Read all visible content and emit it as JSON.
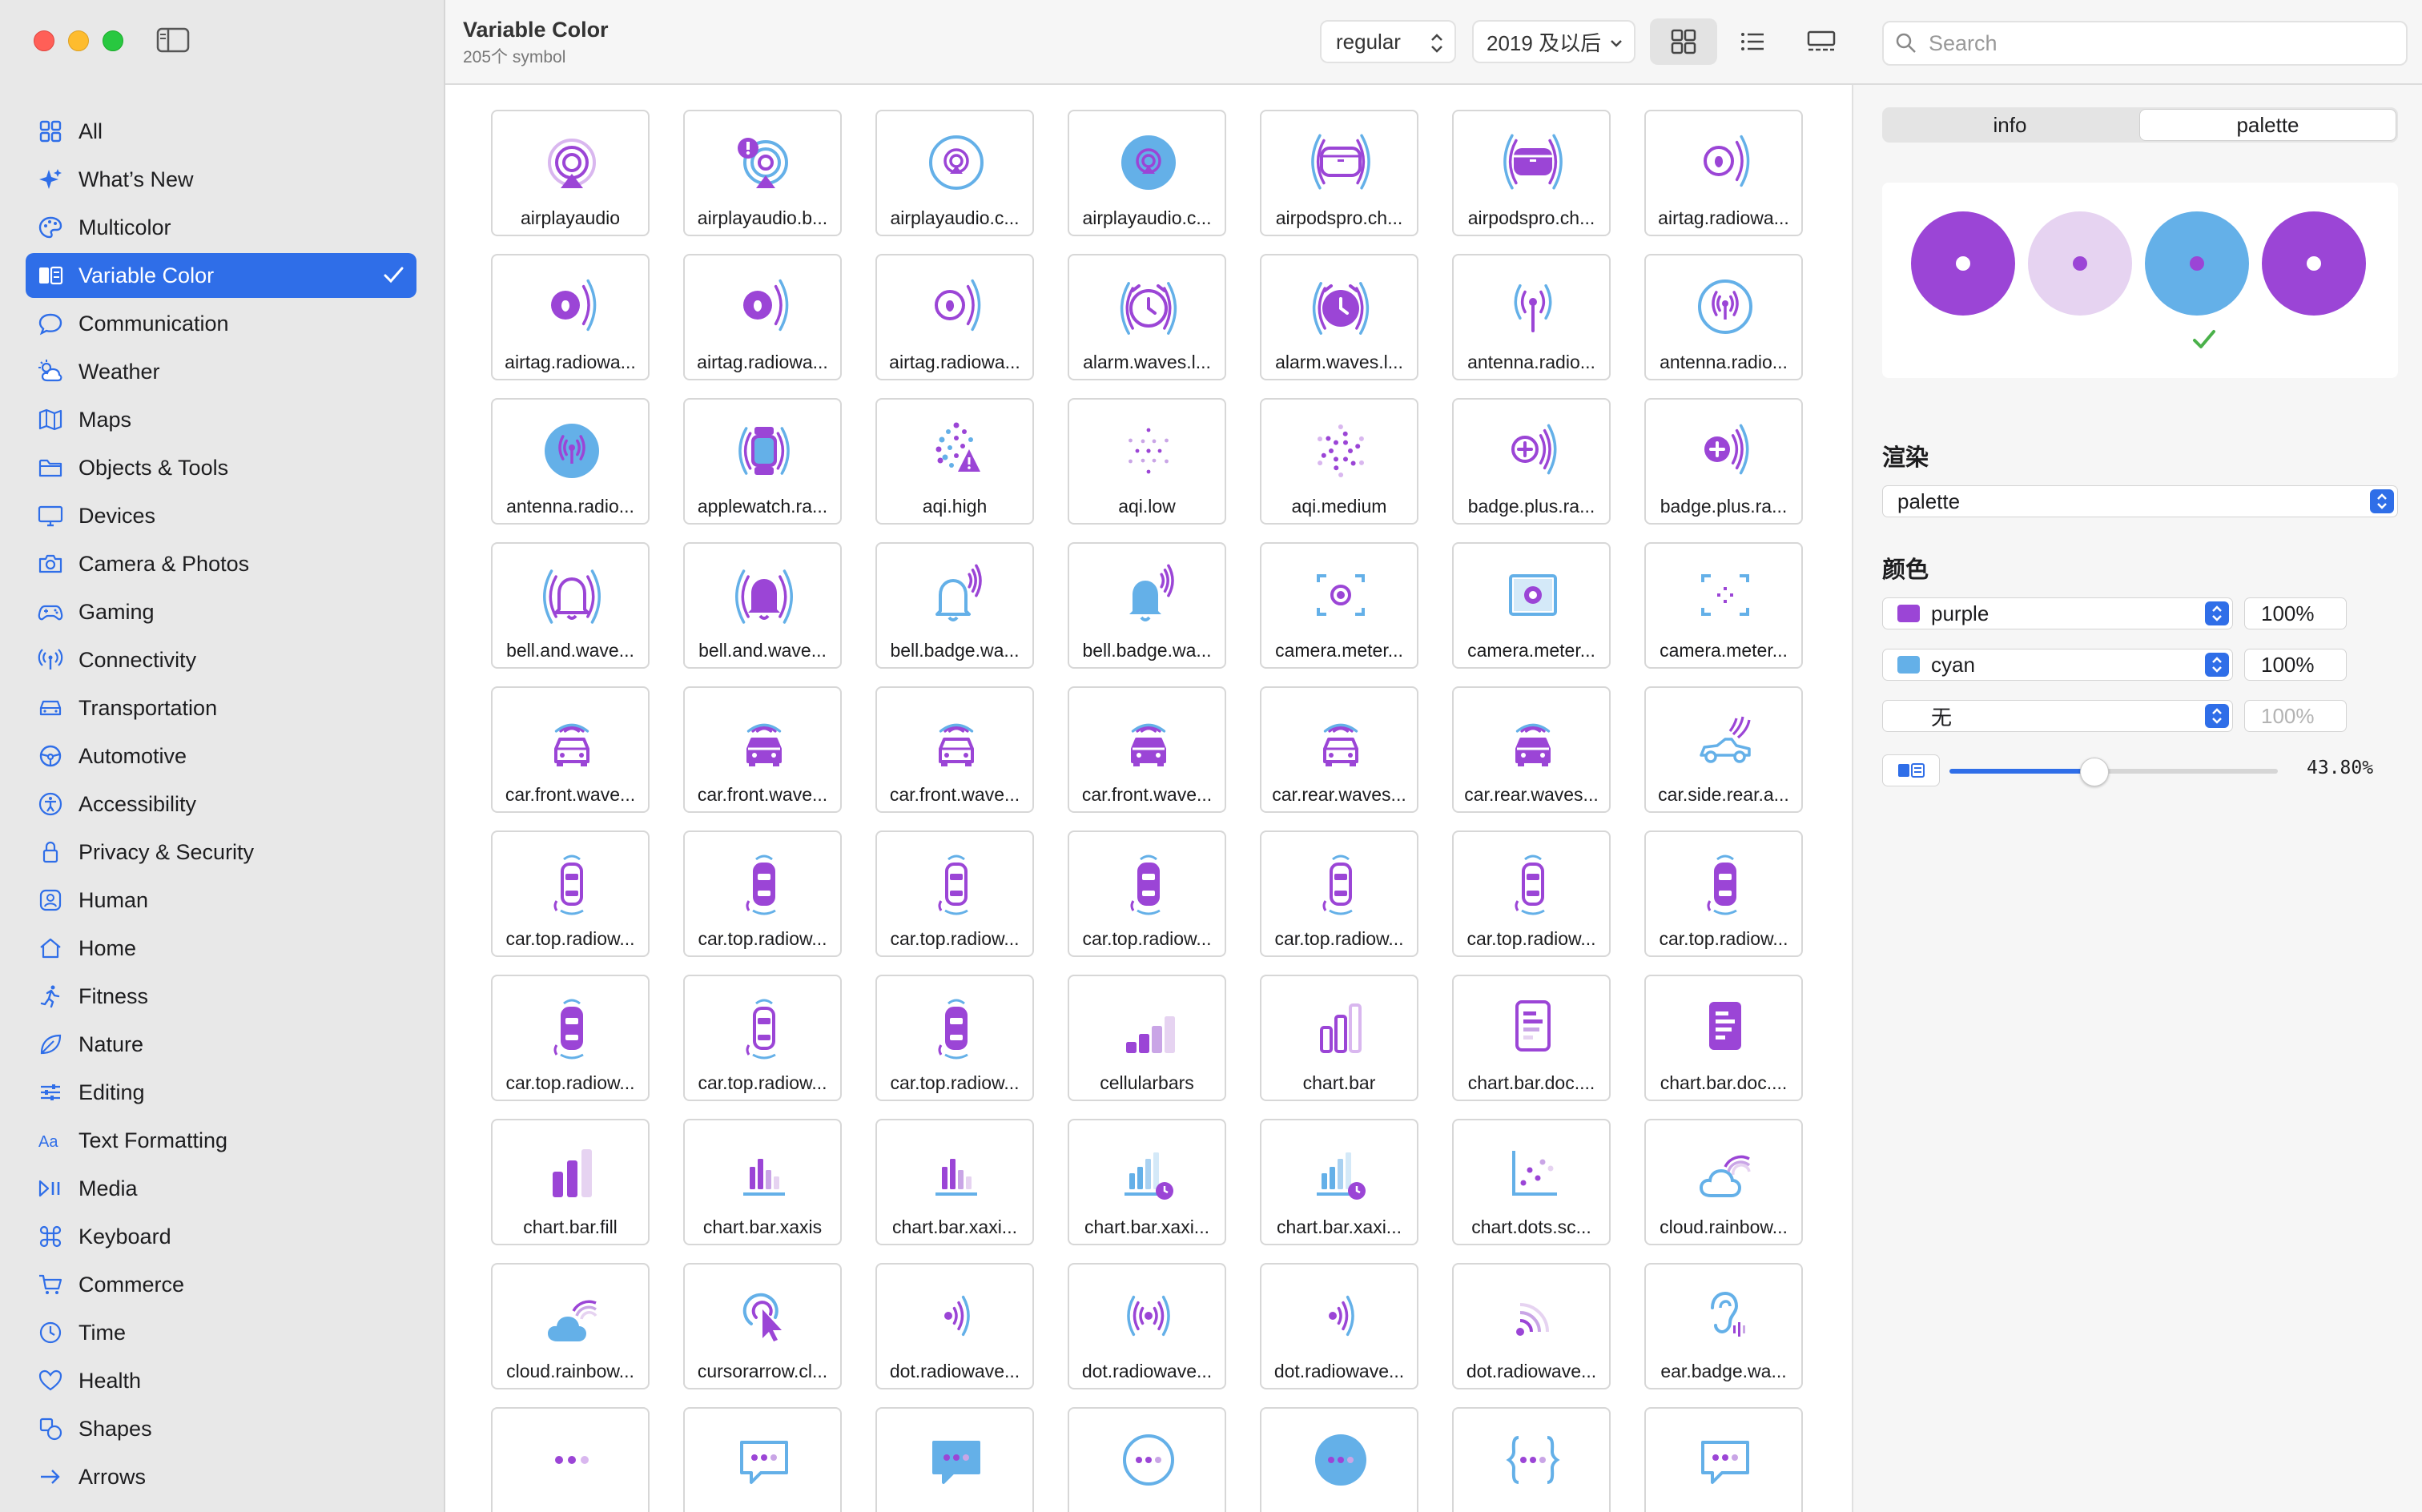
{
  "window": {
    "title": "Variable Color",
    "subtitle": "205个 symbol"
  },
  "toolbar": {
    "weight": "regular",
    "year": "2019 及以后",
    "search_placeholder": "Search"
  },
  "sidebar": {
    "items": [
      {
        "label": "All",
        "icon": "grid-icon"
      },
      {
        "label": "What’s New",
        "icon": "sparkles-icon"
      },
      {
        "label": "Multicolor",
        "icon": "paintpalette-icon"
      },
      {
        "label": "Variable Color",
        "icon": "variable-color-icon",
        "active": true
      },
      {
        "label": "Communication",
        "icon": "message-bubble-icon"
      },
      {
        "label": "Weather",
        "icon": "cloud-sun-icon"
      },
      {
        "label": "Maps",
        "icon": "map-icon"
      },
      {
        "label": "Objects & Tools",
        "icon": "folder-icon"
      },
      {
        "label": "Devices",
        "icon": "desktop-icon"
      },
      {
        "label": "Camera & Photos",
        "icon": "camera-icon"
      },
      {
        "label": "Gaming",
        "icon": "gamecontroller-icon"
      },
      {
        "label": "Connectivity",
        "icon": "antenna-icon"
      },
      {
        "label": "Transportation",
        "icon": "car-icon"
      },
      {
        "label": "Automotive",
        "icon": "steering-wheel-icon"
      },
      {
        "label": "Accessibility",
        "icon": "accessibility-icon"
      },
      {
        "label": "Privacy & Security",
        "icon": "lock-icon"
      },
      {
        "label": "Human",
        "icon": "person-icon"
      },
      {
        "label": "Home",
        "icon": "house-icon"
      },
      {
        "label": "Fitness",
        "icon": "figure-run-icon"
      },
      {
        "label": "Nature",
        "icon": "leaf-icon"
      },
      {
        "label": "Editing",
        "icon": "sliders-icon"
      },
      {
        "label": "Text Formatting",
        "icon": "textformat-icon"
      },
      {
        "label": "Media",
        "icon": "play-pause-icon"
      },
      {
        "label": "Keyboard",
        "icon": "command-icon"
      },
      {
        "label": "Commerce",
        "icon": "cart-icon"
      },
      {
        "label": "Time",
        "icon": "clock-icon"
      },
      {
        "label": "Health",
        "icon": "heart-icon"
      },
      {
        "label": "Shapes",
        "icon": "shapes-icon"
      },
      {
        "label": "Arrows",
        "icon": "arrow-right-icon"
      }
    ]
  },
  "grid": {
    "symbols": [
      {
        "label": "airplayaudio",
        "icon": "airplay-rings-icon"
      },
      {
        "label": "airplayaudio.b...",
        "icon": "airplay-badge-icon"
      },
      {
        "label": "airplayaudio.c...",
        "icon": "airplay-circle-icon"
      },
      {
        "label": "airplayaudio.c...",
        "icon": "airplay-circle-fill-icon"
      },
      {
        "label": "airpodspro.ch...",
        "icon": "airpods-case-icon"
      },
      {
        "label": "airpodspro.ch...",
        "icon": "airpods-case-fill-icon"
      },
      {
        "label": "airtag.radiowa...",
        "icon": "airtag-waves-icon"
      },
      {
        "label": "airtag.radiowa...",
        "icon": "airtag-waves-fill-icon"
      },
      {
        "label": "airtag.radiowa...",
        "icon": "airtag-waves-fill-icon"
      },
      {
        "label": "airtag.radiowa...",
        "icon": "airtag-waves-icon"
      },
      {
        "label": "alarm.waves.l...",
        "icon": "alarm-icon"
      },
      {
        "label": "alarm.waves.l...",
        "icon": "alarm-fill-icon"
      },
      {
        "label": "antenna.radio...",
        "icon": "antenna-icon"
      },
      {
        "label": "antenna.radio...",
        "icon": "antenna-circle-icon"
      },
      {
        "label": "antenna.radio...",
        "icon": "antenna-circle-fill-icon"
      },
      {
        "label": "applewatch.ra...",
        "icon": "applewatch-icon"
      },
      {
        "label": "aqi.high",
        "icon": "aqi-high-icon"
      },
      {
        "label": "aqi.low",
        "icon": "aqi-low-icon"
      },
      {
        "label": "aqi.medium",
        "icon": "aqi-medium-icon"
      },
      {
        "label": "badge.plus.ra...",
        "icon": "badge-plus-icon"
      },
      {
        "label": "badge.plus.ra...",
        "icon": "badge-plus-fill-icon"
      },
      {
        "label": "bell.and.wave...",
        "icon": "bell-waves-icon"
      },
      {
        "label": "bell.and.wave...",
        "icon": "bell-waves-fill-icon"
      },
      {
        "label": "bell.badge.wa...",
        "icon": "bell-badge-icon"
      },
      {
        "label": "bell.badge.wa...",
        "icon": "bell-badge-fill-icon"
      },
      {
        "label": "camera.meter...",
        "icon": "camera-metering-icon"
      },
      {
        "label": "camera.meter...",
        "icon": "camera-metering-fill-icon"
      },
      {
        "label": "camera.meter...",
        "icon": "camera-metering-dots-icon"
      },
      {
        "label": "car.front.wave...",
        "icon": "car-front-icon"
      },
      {
        "label": "car.front.wave...",
        "icon": "car-front-fill-icon"
      },
      {
        "label": "car.front.wave...",
        "icon": "car-front-icon"
      },
      {
        "label": "car.front.wave...",
        "icon": "car-front-fill-icon"
      },
      {
        "label": "car.rear.waves...",
        "icon": "car-rear-icon"
      },
      {
        "label": "car.rear.waves...",
        "icon": "car-rear-fill-icon"
      },
      {
        "label": "car.side.rear.a...",
        "icon": "car-side-icon"
      },
      {
        "label": "car.top.radiow...",
        "icon": "car-top-icon"
      },
      {
        "label": "car.top.radiow...",
        "icon": "car-top-fill-icon"
      },
      {
        "label": "car.top.radiow...",
        "icon": "car-top-icon"
      },
      {
        "label": "car.top.radiow...",
        "icon": "car-top-fill-icon"
      },
      {
        "label": "car.top.radiow...",
        "icon": "car-top-icon"
      },
      {
        "label": "car.top.radiow...",
        "icon": "car-top-icon"
      },
      {
        "label": "car.top.radiow...",
        "icon": "car-top-fill-icon"
      },
      {
        "label": "car.top.radiow...",
        "icon": "car-top-fill-icon"
      },
      {
        "label": "car.top.radiow...",
        "icon": "car-top-icon"
      },
      {
        "label": "car.top.radiow...",
        "icon": "car-top-fill-icon"
      },
      {
        "label": "cellularbars",
        "icon": "cellularbars-icon"
      },
      {
        "label": "chart.bar",
        "icon": "chart-bar-icon"
      },
      {
        "label": "chart.bar.doc....",
        "icon": "chart-doc-icon"
      },
      {
        "label": "chart.bar.doc....",
        "icon": "chart-doc-fill-icon"
      },
      {
        "label": "chart.bar.fill",
        "icon": "chart-bar-fill-icon"
      },
      {
        "label": "chart.bar.xaxis",
        "icon": "chart-xaxis-icon"
      },
      {
        "label": "chart.bar.xaxi...",
        "icon": "chart-xaxis-icon"
      },
      {
        "label": "chart.bar.xaxi...",
        "icon": "chart-xaxis-clock-icon"
      },
      {
        "label": "chart.bar.xaxi...",
        "icon": "chart-xaxis-clock-icon"
      },
      {
        "label": "chart.dots.sc...",
        "icon": "chart-dots-icon"
      },
      {
        "label": "cloud.rainbow...",
        "icon": "cloud-rainbow-icon"
      },
      {
        "label": "cloud.rainbow...",
        "icon": "cloud-rainbow-fill-icon"
      },
      {
        "label": "cursorarrow.cl...",
        "icon": "cursor-click-icon"
      },
      {
        "label": "dot.radiowave...",
        "icon": "dot-radiowaves-right-icon"
      },
      {
        "label": "dot.radiowave...",
        "icon": "dot-radiowaves-both-icon"
      },
      {
        "label": "dot.radiowave...",
        "icon": "dot-radiowaves-right-icon"
      },
      {
        "label": "dot.radiowave...",
        "icon": "dot-radiowaves-up-icon"
      },
      {
        "label": "ear.badge.wa...",
        "icon": "ear-waves-icon"
      },
      {
        "label": "",
        "icon": "ellipsis-icon"
      },
      {
        "label": "",
        "icon": "bubble-ellipsis-icon"
      },
      {
        "label": "",
        "icon": "bubble-ellipsis-fill-icon"
      },
      {
        "label": "",
        "icon": "ellipsis-circle-icon"
      },
      {
        "label": "",
        "icon": "ellipsis-circle-fill-icon"
      },
      {
        "label": "",
        "icon": "curlybraces-icon"
      },
      {
        "label": "",
        "icon": "bubble-ellipsis-icon"
      }
    ]
  },
  "inspector": {
    "tabs": [
      {
        "label": "info"
      },
      {
        "label": "palette",
        "selected": true
      }
    ],
    "render_title": "渲染",
    "render_mode": "palette",
    "color_title": "颜色",
    "colors": [
      {
        "name": "purple",
        "swatch": "#9b45d6",
        "percent": "100%"
      },
      {
        "name": "cyan",
        "swatch": "#64b0e8",
        "percent": "100%"
      },
      {
        "name": "无",
        "swatch": "",
        "percent": "100%",
        "disabled": true
      }
    ],
    "variable_value": 0.438,
    "variable_value_text": "43.80%",
    "palette_preview": [
      "#9b45d6",
      "#e6d3f1",
      "#64b0e8",
      "#9b45d6"
    ]
  },
  "colors": {
    "accent": "#2f6ee8",
    "purple": "#9b45d6",
    "purple_light": "#d9b7ef",
    "cyan": "#64b0e8",
    "check_green": "#4ab14a"
  }
}
